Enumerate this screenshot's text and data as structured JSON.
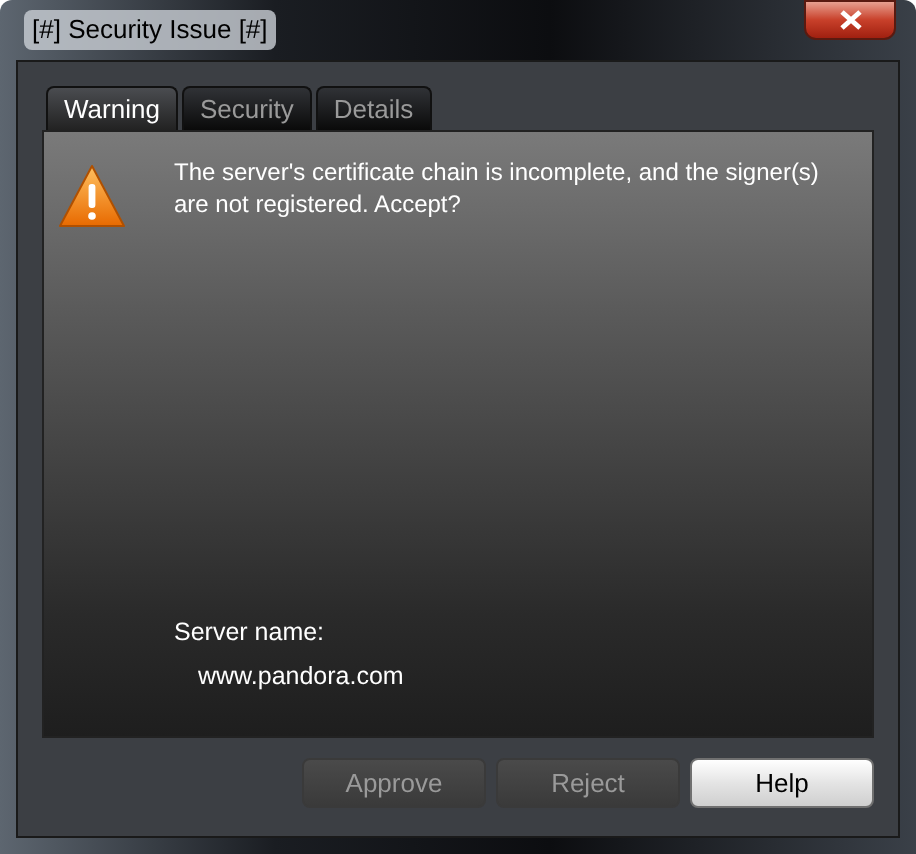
{
  "window": {
    "title": "[#] Security Issue [#]"
  },
  "tabs": [
    {
      "label": "Warning",
      "selected": true
    },
    {
      "label": "Security",
      "selected": false
    },
    {
      "label": "Details",
      "selected": false
    }
  ],
  "message": "The server's certificate chain is incomplete, and the signer(s) are not registered. Accept?",
  "server_name": {
    "label": "Server name:",
    "value": "www.pandora.com"
  },
  "buttons": [
    {
      "label": "Approve",
      "disabled": true
    },
    {
      "label": "Reject",
      "disabled": true
    },
    {
      "label": "Help",
      "disabled": false
    }
  ]
}
